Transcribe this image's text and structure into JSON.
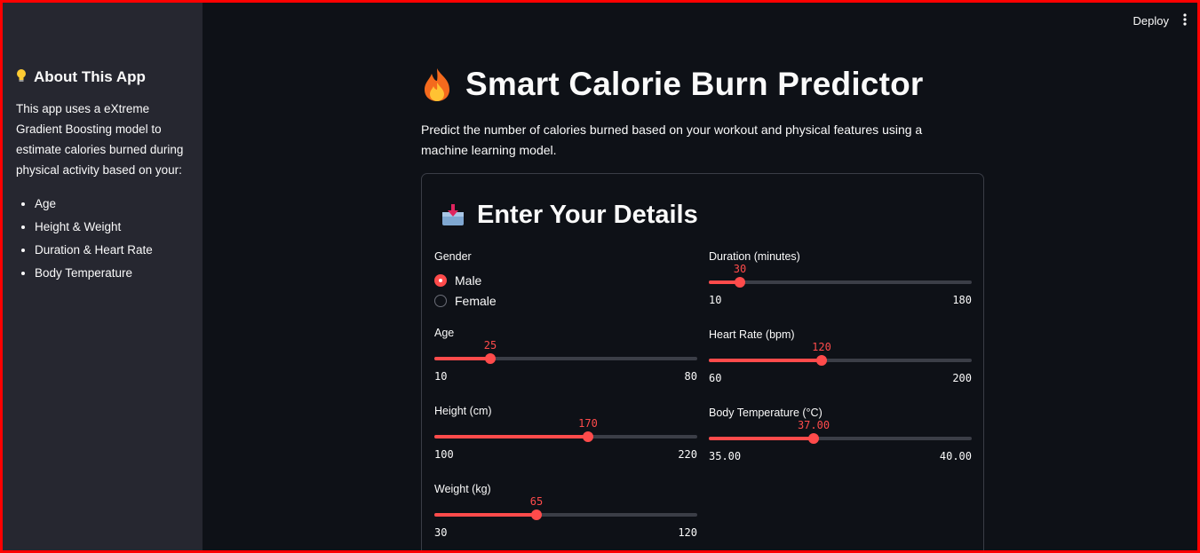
{
  "topbar": {
    "deploy_label": "Deploy",
    "menu_icon": "kebab-menu-icon"
  },
  "sidebar": {
    "heading": "About This App",
    "heading_icon": "lightbulb-icon",
    "description": "This app uses a eXtreme Gradient Boosting model to estimate calories burned during physical activity based on your:",
    "features": [
      "Age",
      "Height & Weight",
      "Duration & Heart Rate",
      "Body Temperature"
    ]
  },
  "main": {
    "title": "Smart Calorie Burn Predictor",
    "title_icon": "fire-icon",
    "description": "Predict the number of calories burned based on your workout and physical features using a machine learning model.",
    "form": {
      "heading": "Enter Your Details",
      "heading_icon": "inbox-tray-icon",
      "gender": {
        "label": "Gender",
        "options": [
          "Male",
          "Female"
        ],
        "selected": "Male"
      },
      "left_sliders": [
        {
          "name": "age",
          "label": "Age",
          "value": "25",
          "min": "10",
          "max": "80",
          "num": 25,
          "lo": 10,
          "hi": 80
        },
        {
          "name": "height",
          "label": "Height (cm)",
          "value": "170",
          "min": "100",
          "max": "220",
          "num": 170,
          "lo": 100,
          "hi": 220
        },
        {
          "name": "weight",
          "label": "Weight (kg)",
          "value": "65",
          "min": "30",
          "max": "120",
          "num": 65,
          "lo": 30,
          "hi": 120
        }
      ],
      "right_sliders": [
        {
          "name": "duration",
          "label": "Duration (minutes)",
          "value": "30",
          "min": "10",
          "max": "180",
          "num": 30,
          "lo": 10,
          "hi": 180
        },
        {
          "name": "heart-rate",
          "label": "Heart Rate (bpm)",
          "value": "120",
          "min": "60",
          "max": "200",
          "num": 120,
          "lo": 60,
          "hi": 200
        },
        {
          "name": "body-temperature",
          "label": "Body Temperature (°C)",
          "value": "37.00",
          "min": "35.00",
          "max": "40.00",
          "num": 37,
          "lo": 35,
          "hi": 40
        }
      ]
    }
  },
  "colors": {
    "accent": "#ff4b4b",
    "background": "#0e1117",
    "sidebar": "#262730"
  }
}
